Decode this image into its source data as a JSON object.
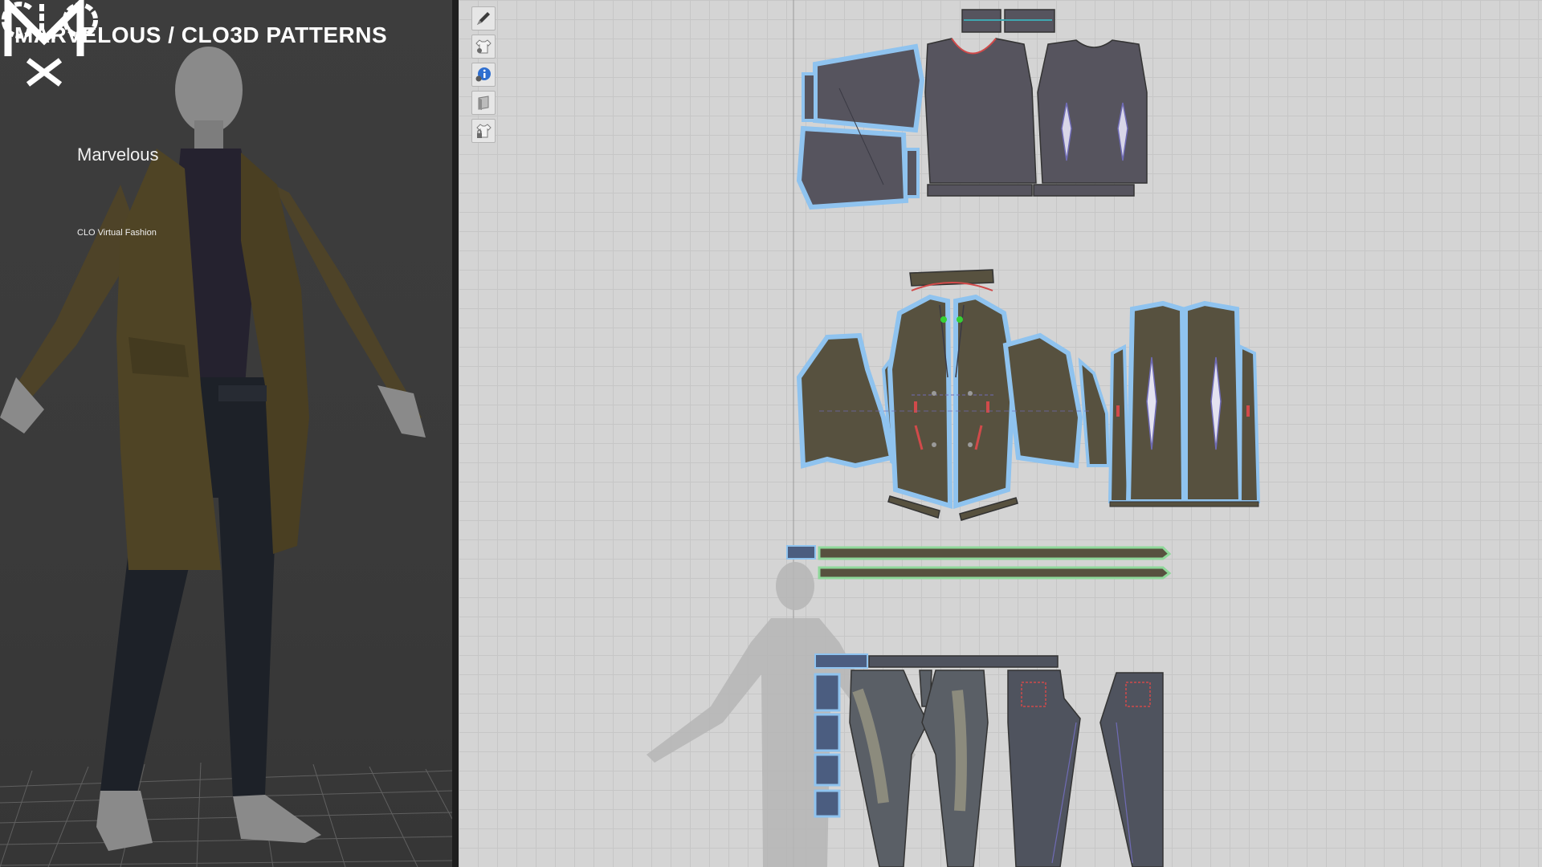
{
  "header": {
    "title": "MARVELOUS / CLO3D PATTERNS"
  },
  "logos": {
    "marvelous_label": "Marvelous",
    "clo_label": "CLO Virtual Fashion"
  },
  "toolbar": {
    "tools": [
      {
        "icon": "pen-icon"
      },
      {
        "icon": "garment-show-icon"
      },
      {
        "icon": "info-icon"
      },
      {
        "icon": "texture-icon"
      },
      {
        "icon": "lock-garment-icon"
      }
    ]
  },
  "colors": {
    "coat_fabric": "#57513f",
    "shirt_fabric": "#55535f",
    "pants_fabric": "#4f535e",
    "selection_outline": "#8fc3ef",
    "seam_line": "#d14a4a",
    "belt_outline": "#8fd89a"
  }
}
